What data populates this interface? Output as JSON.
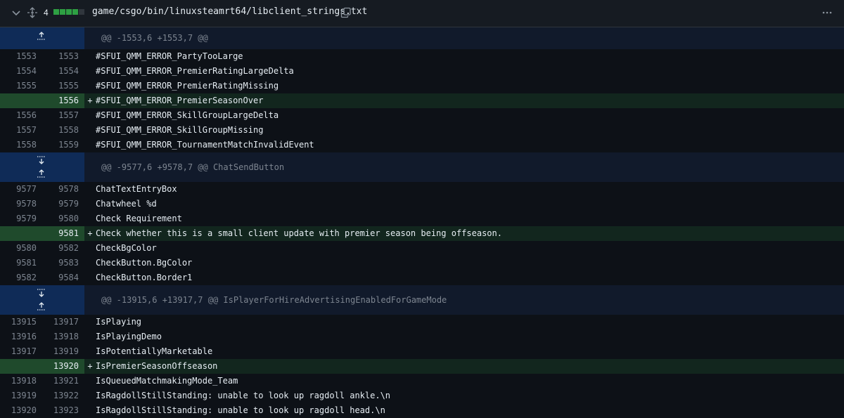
{
  "header": {
    "changes_count": "4",
    "file_path": "game/csgo/bin/linuxsteamrt64/libclient_strings.txt",
    "icons": [
      "chevron-down-icon",
      "unfold-icon",
      "copy-icon",
      "kebab-horizontal-icon"
    ],
    "diffstat_colors": [
      "#2ea043",
      "#2ea043",
      "#2ea043",
      "#2ea043",
      "#30363d"
    ]
  },
  "colors": {
    "addition_bg": "#12261e",
    "addition_gutter": "#1f4a2c",
    "hunk_gutter": "#0f2b57",
    "hunk_bg": "#111a2b"
  },
  "hunks": [
    {
      "header": "@@ -1553,6 +1553,7 @@",
      "lines": [
        {
          "old": "1553",
          "new": "1553",
          "marker": "",
          "code": "#SFUI_QMM_ERROR_PartyTooLarge",
          "type": "ctx"
        },
        {
          "old": "1554",
          "new": "1554",
          "marker": "",
          "code": "#SFUI_QMM_ERROR_PremierRatingLargeDelta",
          "type": "ctx"
        },
        {
          "old": "1555",
          "new": "1555",
          "marker": "",
          "code": "#SFUI_QMM_ERROR_PremierRatingMissing",
          "type": "ctx"
        },
        {
          "old": "",
          "new": "1556",
          "marker": "+",
          "code": "#SFUI_QMM_ERROR_PremierSeasonOver",
          "type": "add"
        },
        {
          "old": "1556",
          "new": "1557",
          "marker": "",
          "code": "#SFUI_QMM_ERROR_SkillGroupLargeDelta",
          "type": "ctx"
        },
        {
          "old": "1557",
          "new": "1558",
          "marker": "",
          "code": "#SFUI_QMM_ERROR_SkillGroupMissing",
          "type": "ctx"
        },
        {
          "old": "1558",
          "new": "1559",
          "marker": "",
          "code": "#SFUI_QMM_ERROR_TournamentMatchInvalidEvent",
          "type": "ctx"
        }
      ]
    },
    {
      "header": "@@ -9577,6 +9578,7 @@ ChatSendButton",
      "lines": [
        {
          "old": "9577",
          "new": "9578",
          "marker": "",
          "code": "ChatTextEntryBox",
          "type": "ctx"
        },
        {
          "old": "9578",
          "new": "9579",
          "marker": "",
          "code": "Chatwheel %d",
          "type": "ctx"
        },
        {
          "old": "9579",
          "new": "9580",
          "marker": "",
          "code": "Check Requirement",
          "type": "ctx"
        },
        {
          "old": "",
          "new": "9581",
          "marker": "+",
          "code": "Check whether this is a small client update with premier season being offseason.",
          "type": "add"
        },
        {
          "old": "9580",
          "new": "9582",
          "marker": "",
          "code": "CheckBgColor",
          "type": "ctx"
        },
        {
          "old": "9581",
          "new": "9583",
          "marker": "",
          "code": "CheckButton.BgColor",
          "type": "ctx"
        },
        {
          "old": "9582",
          "new": "9584",
          "marker": "",
          "code": "CheckButton.Border1",
          "type": "ctx"
        }
      ]
    },
    {
      "header": "@@ -13915,6 +13917,7 @@ IsPlayerForHireAdvertisingEnabledForGameMode",
      "lines": [
        {
          "old": "13915",
          "new": "13917",
          "marker": "",
          "code": "IsPlaying",
          "type": "ctx"
        },
        {
          "old": "13916",
          "new": "13918",
          "marker": "",
          "code": "IsPlayingDemo",
          "type": "ctx"
        },
        {
          "old": "13917",
          "new": "13919",
          "marker": "",
          "code": "IsPotentiallyMarketable",
          "type": "ctx"
        },
        {
          "old": "",
          "new": "13920",
          "marker": "+",
          "code": "IsPremierSeasonOffseason",
          "type": "add"
        },
        {
          "old": "13918",
          "new": "13921",
          "marker": "",
          "code": "IsQueuedMatchmakingMode_Team",
          "type": "ctx"
        },
        {
          "old": "13919",
          "new": "13922",
          "marker": "",
          "code": "IsRagdollStillStanding: unable to look up ragdoll ankle.\\n",
          "type": "ctx"
        },
        {
          "old": "13920",
          "new": "13923",
          "marker": "",
          "code": "IsRagdollStillStanding: unable to look up ragdoll head.\\n",
          "type": "ctx"
        }
      ]
    }
  ]
}
